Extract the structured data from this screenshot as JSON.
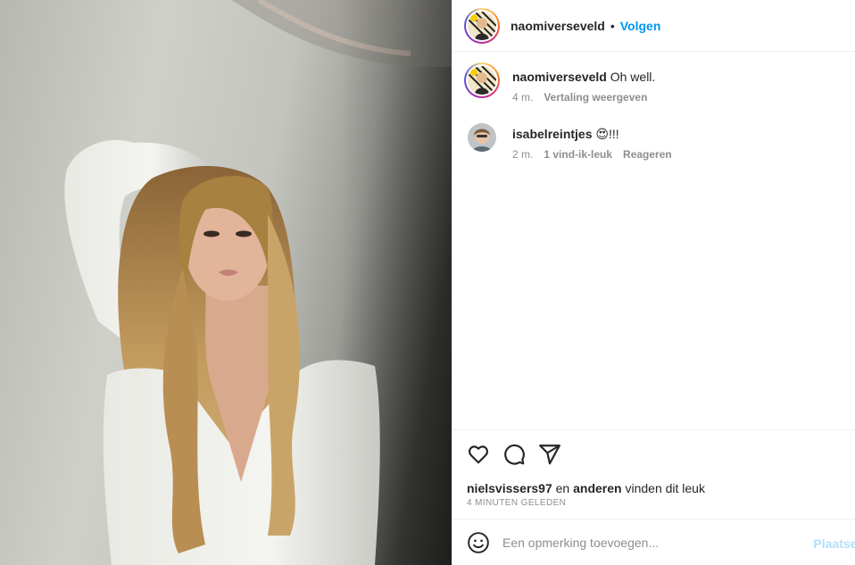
{
  "post": {
    "author": "naomiverseveld",
    "follow_dot": "•",
    "follow_label": "Volgen"
  },
  "comments": [
    {
      "username": "naomiverseveld",
      "text": "Oh well.",
      "time": "4 m.",
      "actions": [
        "Vertaling weergeven"
      ]
    },
    {
      "username": "isabelreintjes",
      "text": "😍!!!",
      "time": "2 m.",
      "actions": [
        "1 vind-ik-leuk",
        "Reageren"
      ]
    }
  ],
  "actions": {
    "icons": [
      "heart-icon",
      "comment-icon",
      "share-icon"
    ]
  },
  "likes": {
    "user": "nielsvissers97",
    "connector": "en",
    "others": "anderen",
    "suffix": "vinden dit leuk"
  },
  "timestamp": "4 MINUTEN GELEDEN",
  "comment_input": {
    "placeholder": "Een opmerking toevoegen...",
    "post_label": "Plaatsen"
  },
  "colors": {
    "accent": "#0095f6",
    "text": "#262626",
    "muted": "#8e8e8e",
    "border": "#efefef",
    "post_disabled": "#b2dffc"
  }
}
